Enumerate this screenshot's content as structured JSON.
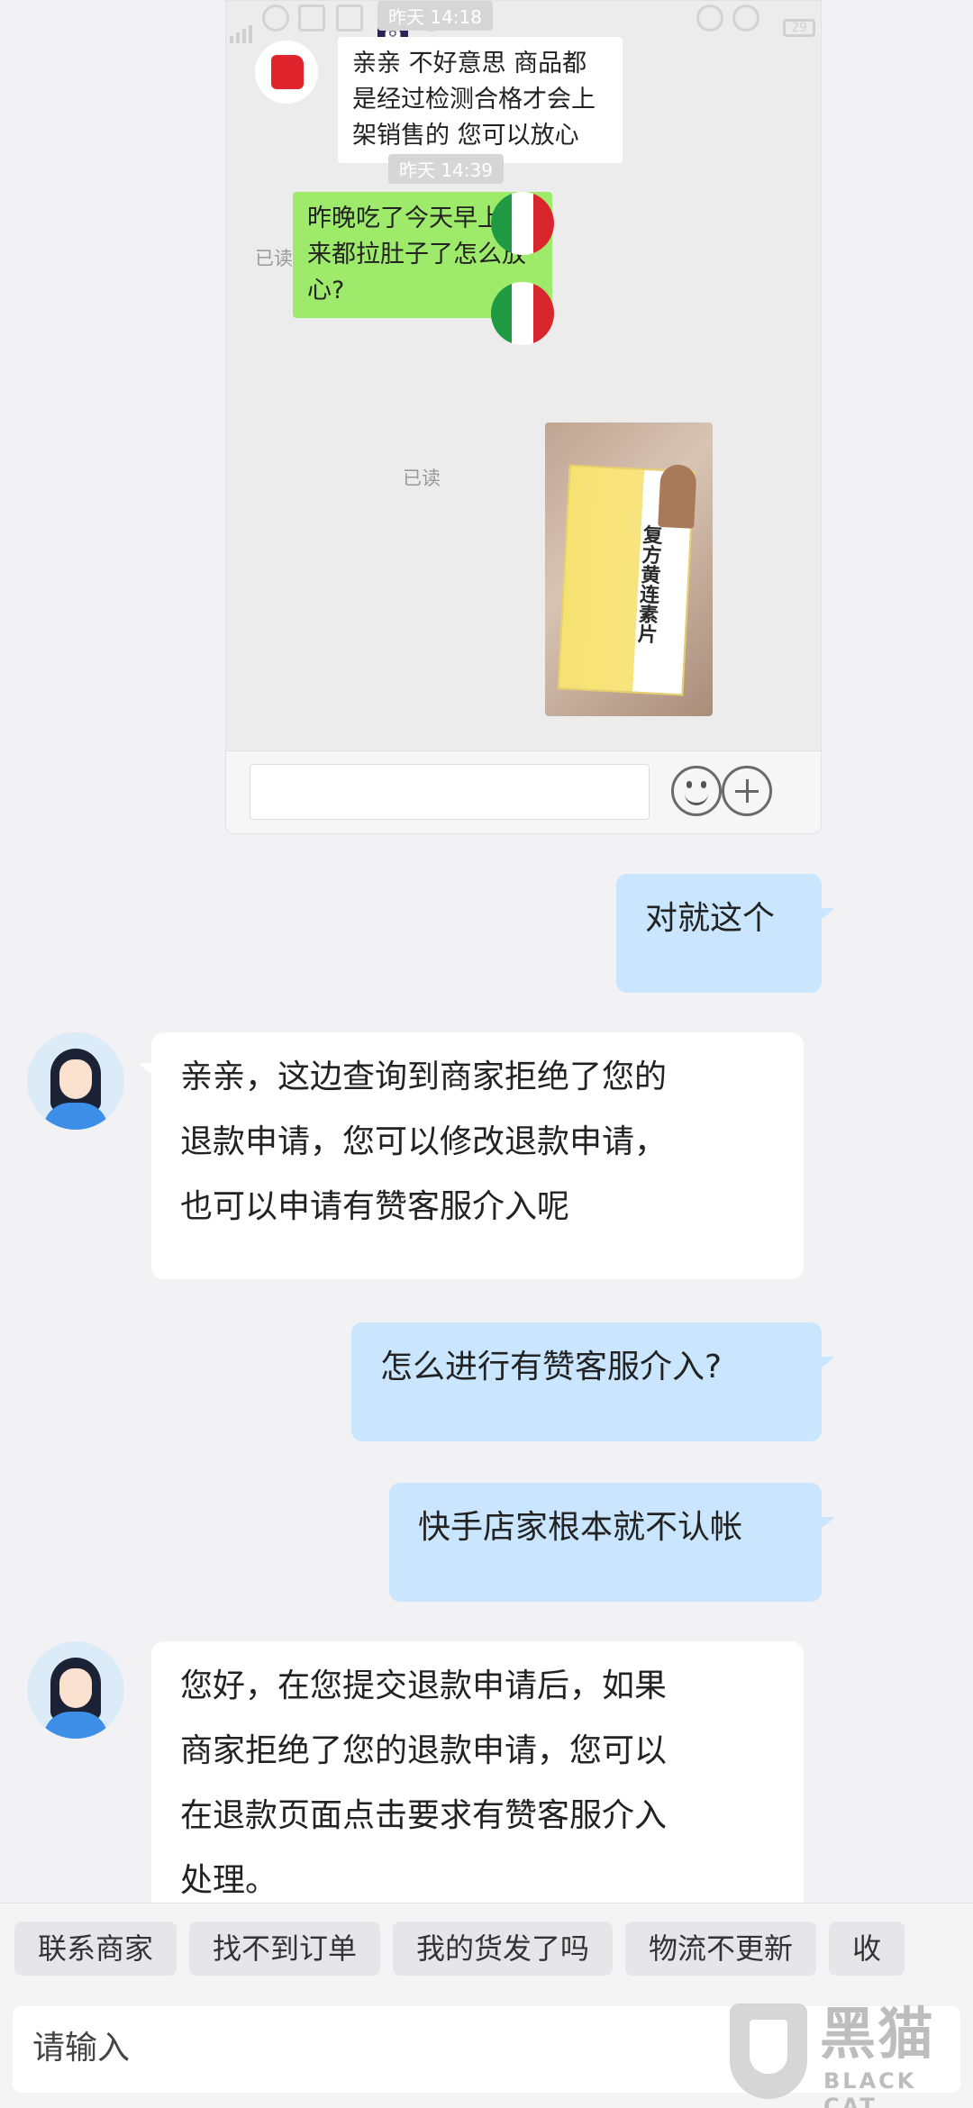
{
  "embedded_screenshot": {
    "status_bar": {
      "time_label": "昨天 14:18"
    },
    "merchant_reply": "亲亲  不好意思  商品都是经过检测合格才会上架销售的  您可以放心",
    "time_chip_2": "昨天 14:39",
    "customer_message": "昨晚吃了今天早上起来都拉肚子了怎么放心?",
    "read_label_1": "已读",
    "photo_medicine_name": "复方黄连素片",
    "read_label_2": "已读"
  },
  "messages": [
    {
      "side": "out",
      "text": "对就这个"
    },
    {
      "side": "in",
      "lines": [
        "亲亲，这边查询到商家拒绝了您的",
        "退款申请，您可以修改退款申请，",
        "也可以申请有赞客服介入呢"
      ]
    },
    {
      "side": "out",
      "text": "怎么进行有赞客服介入?"
    },
    {
      "side": "out",
      "text": "快手店家根本就不认帐"
    },
    {
      "side": "in",
      "lines": [
        "您好，在您提交退款申请后，如果",
        "商家拒绝了您的退款申请，您可以",
        "在退款页面点击要求有赞客服介入",
        "处理。"
      ]
    }
  ],
  "quick_replies": [
    "联系商家",
    "找不到订单",
    "我的货发了吗",
    "物流不更新",
    "收"
  ],
  "input": {
    "placeholder": "请输入"
  },
  "watermark": {
    "cn": "黑猫",
    "en": "BLACK CAT"
  },
  "colors": {
    "outgoing_bubble": "#cae6ff",
    "incoming_bubble": "#ffffff",
    "wechat_green": "#9eea6a"
  }
}
